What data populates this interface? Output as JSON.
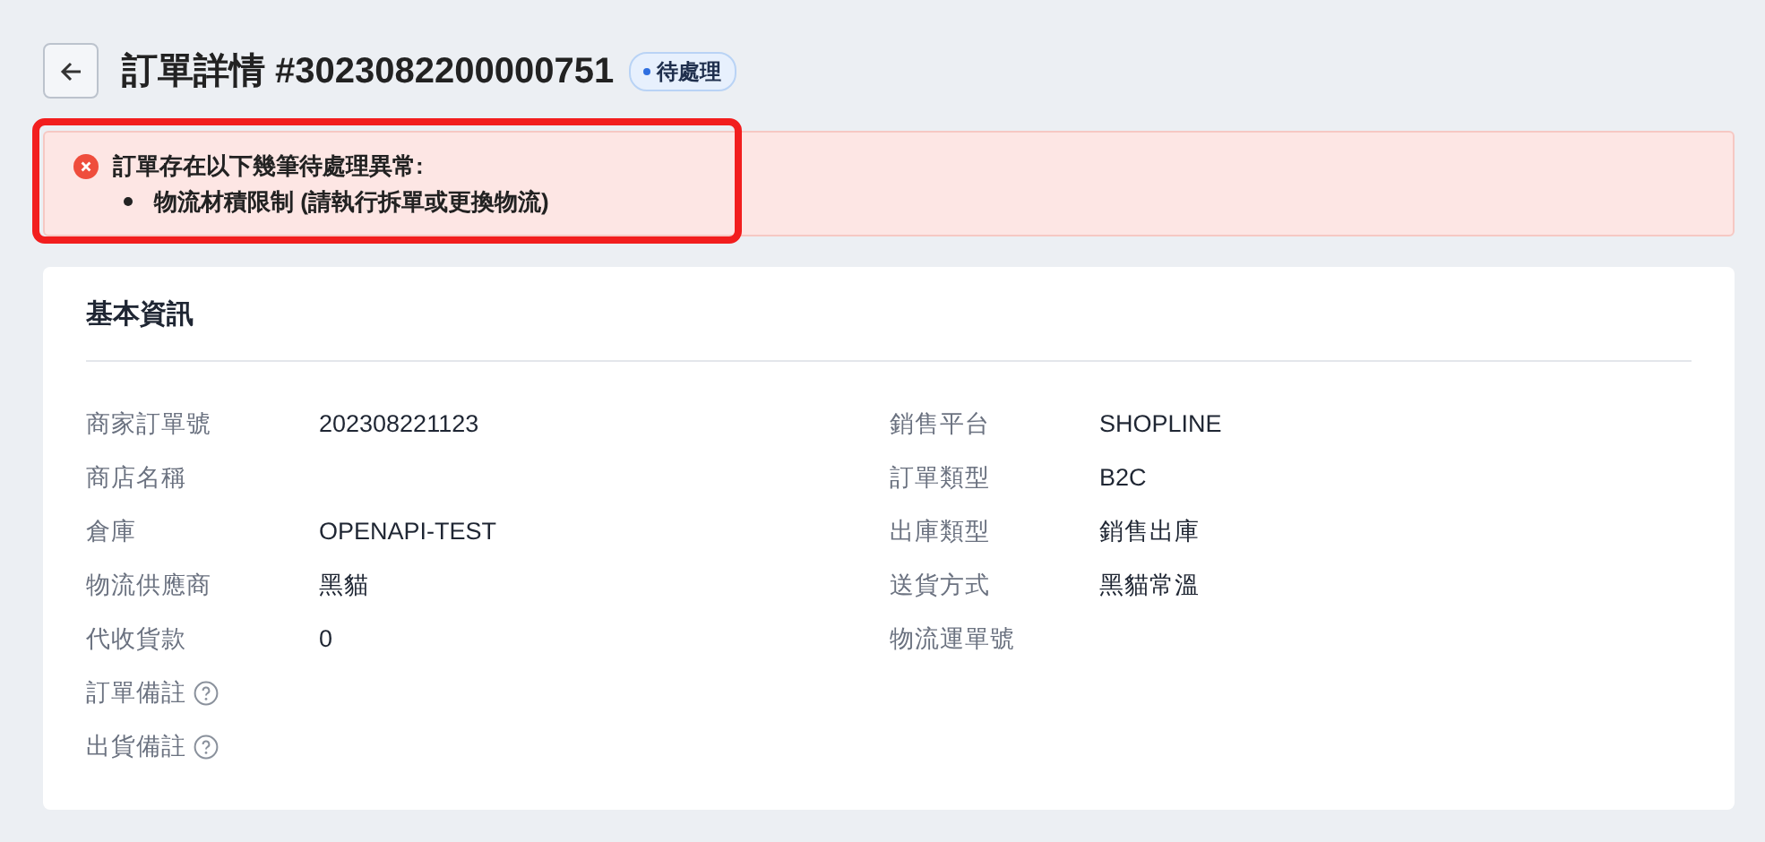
{
  "header": {
    "title": "訂單詳情 #3023082200000751",
    "status": "待處理"
  },
  "alert": {
    "message": "訂單存在以下幾筆待處理異常:",
    "items": [
      "物流材積限制 (請執行拆單或更換物流)"
    ],
    "highlighted": true
  },
  "card": {
    "title": "基本資訊",
    "left_fields": [
      {
        "label": "商家訂單號",
        "value": "202308221123"
      },
      {
        "label": "商店名稱"
      },
      {
        "label": "倉庫",
        "value": "OPENAPI-TEST"
      },
      {
        "label": "物流供應商",
        "value": "黑貓"
      },
      {
        "label": "代收貨款",
        "value": "0"
      },
      {
        "label": "訂單備註",
        "help": true
      },
      {
        "label": "出貨備註",
        "help": true
      }
    ],
    "right_fields": [
      {
        "label": "銷售平台",
        "value": "SHOPLINE"
      },
      {
        "label": "訂單類型",
        "value": "B2C"
      },
      {
        "label": "出庫類型",
        "value": "銷售出庫"
      },
      {
        "label": "送貨方式",
        "value": "黑貓常溫"
      },
      {
        "label": "物流運單號"
      }
    ]
  }
}
